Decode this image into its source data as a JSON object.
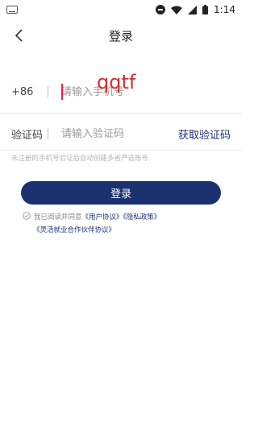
{
  "status_bar": {
    "time": "1:14",
    "icons": [
      "keyboard-icon",
      "do-not-disturb-icon",
      "wifi-icon",
      "signal-icon",
      "battery-icon"
    ]
  },
  "header": {
    "title": "登录",
    "back_icon": "chevron-left-icon"
  },
  "phone": {
    "prefix": "+86",
    "placeholder": "请输入手机号",
    "overlay_text": "qqtf"
  },
  "code": {
    "label": "验证码",
    "placeholder": "请输入验证码",
    "get_code_label": "获取验证码"
  },
  "hint": "未注册的手机号验证后自动创建多省严选账号",
  "login_button": "登录",
  "agreement": {
    "prefix": "我已阅读并同意",
    "user_agreement": "《用户协议》",
    "privacy_policy": "《隐私政策》",
    "partner_agreement": "《灵活就业合作伙伴协议》"
  },
  "colors": {
    "brand": "#1c3170",
    "caret": "#e0244c",
    "overlay": "#d32f2f"
  }
}
